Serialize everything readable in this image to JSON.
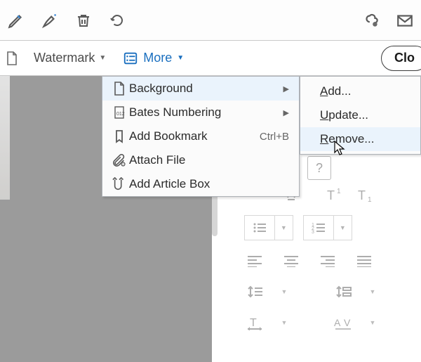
{
  "toolbar2": {
    "watermark_label": "Watermark",
    "more_label": "More",
    "close_label": "Clo"
  },
  "menu_more": {
    "items": [
      {
        "label": "Background",
        "submenu": true
      },
      {
        "label": "Bates Numbering",
        "submenu": true
      },
      {
        "label": "Add Bookmark",
        "accel": "Ctrl+B"
      },
      {
        "label": "Attach File"
      },
      {
        "label": "Add Article Box"
      }
    ]
  },
  "menu_background": {
    "add": "Add...",
    "update": "Update...",
    "remove": "Remove..."
  },
  "right_panel": {
    "help": "?"
  }
}
